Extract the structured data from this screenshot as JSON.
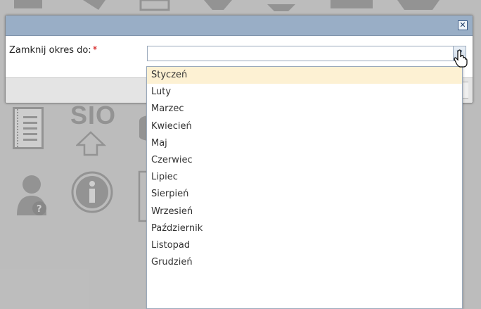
{
  "dialog": {
    "close_symbol": "✕",
    "field_label": "Zamknij okres do:",
    "required_mark": "*",
    "select_value": "",
    "arrow_symbol": "▼"
  },
  "dropdown": {
    "options": [
      "Styczeń",
      "Luty",
      "Marzec",
      "Kwiecień",
      "Maj",
      "Czerwiec",
      "Lipiec",
      "Sierpień",
      "Wrzesień",
      "Październik",
      "Listopad",
      "Grudzień"
    ],
    "highlighted": "Styczeń"
  },
  "background": {
    "sio_text": "SIO"
  },
  "colors": {
    "header": "#99aec6",
    "highlight": "#fdf1d3",
    "required": "#d00000"
  }
}
